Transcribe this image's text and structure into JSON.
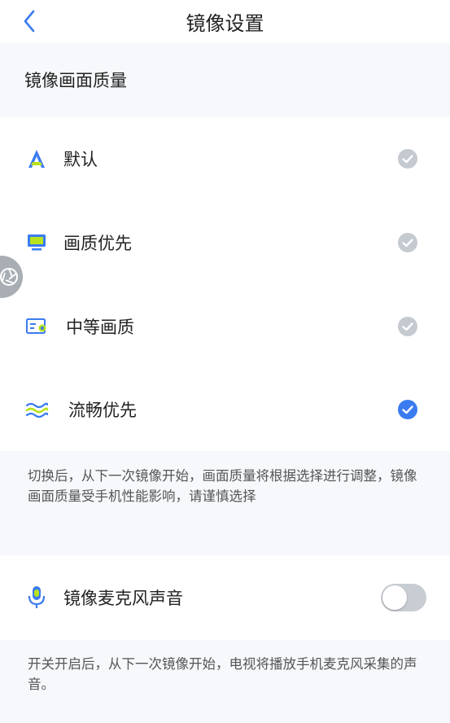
{
  "header": {
    "title": "镜像设置",
    "back_icon": "chevron-left-icon"
  },
  "quality": {
    "section_title": "镜像画面质量",
    "options": [
      {
        "label": "默认",
        "icon": "letter-a-icon",
        "selected": false
      },
      {
        "label": "画质优先",
        "icon": "monitor-icon",
        "selected": false
      },
      {
        "label": "中等画质",
        "icon": "document-badge-icon",
        "selected": false
      },
      {
        "label": "流畅优先",
        "icon": "waves-icon",
        "selected": true
      }
    ],
    "note": "切换后，从下一次镜像开始，画面质量将根据选择进行调整，镜像画面质量受手机性能影响，请谨慎选择"
  },
  "microphone": {
    "label": "镜像麦克风声音",
    "icon": "microphone-icon",
    "enabled": false,
    "note": "开关开启后，从下一次镜像开始，电视将播放手机麦克风采集的声音。"
  },
  "colors": {
    "accent": "#3a7bf0",
    "check_inactive": "#c5c9d0",
    "toggle_off": "#c8ccd3",
    "page_bg": "#f6f8fb"
  }
}
